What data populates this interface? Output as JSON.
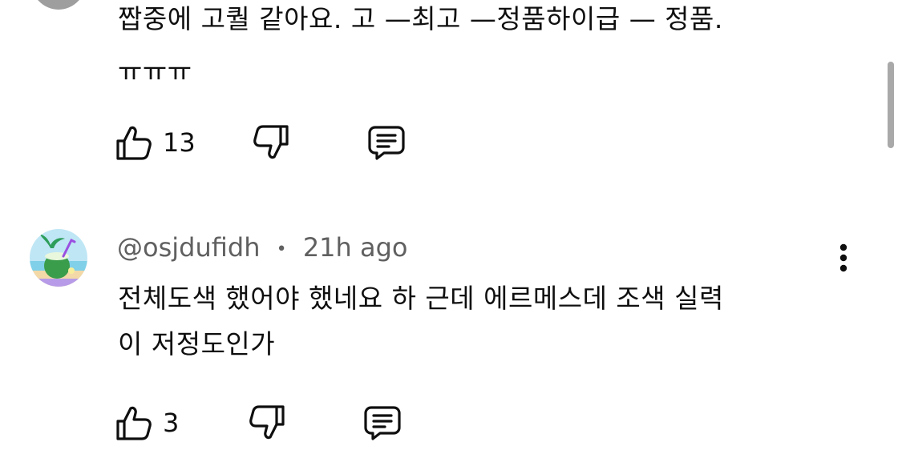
{
  "comment1": {
    "text_line1": "짭중에 고퀄 같아요.  고 —최고 —정품하이급 — 정품.",
    "text_line2": "ㅠㅠㅠ",
    "like_count": "13"
  },
  "comment2": {
    "author": "@osjdufidh",
    "separator": "•",
    "time": "21h ago",
    "text_line1": "전체도색 했어야 했네요 하 근데 에르메스데 조색 실력",
    "text_line2": "이 저정도인가",
    "like_count": "3"
  },
  "icons": {
    "like": "thumbs-up-icon",
    "dislike": "thumbs-down-icon",
    "reply": "reply-comment-icon",
    "more": "more-vertical-icon"
  }
}
